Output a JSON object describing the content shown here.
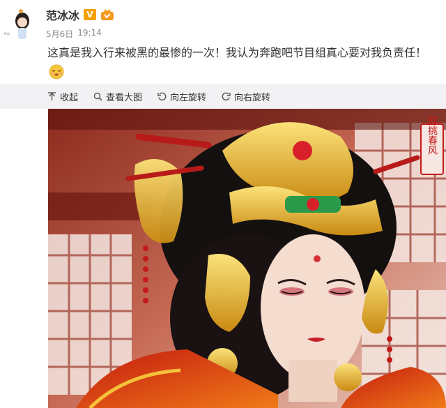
{
  "post": {
    "author": "范冰冰",
    "verified_mark": "V",
    "date": "5月6日",
    "time": "19:14",
    "text": "这真是我入行来被黑的最惨的一次！我认为奔跑吧节目组真心要对我负责任！",
    "emoji_count_inline": 1,
    "emoji_count_second_line": 2
  },
  "toolbar": {
    "collapse_label": "收起",
    "view_large_label": "查看大图",
    "rotate_left_label": "向左旋转",
    "rotate_right_label": "向右旋转"
  },
  "image": {
    "seal_text": "醉挑春风"
  },
  "colors": {
    "toolbar_bg": "#f2f2f5",
    "verified": "#f5a000",
    "text": "#333333",
    "meta": "#888888"
  }
}
